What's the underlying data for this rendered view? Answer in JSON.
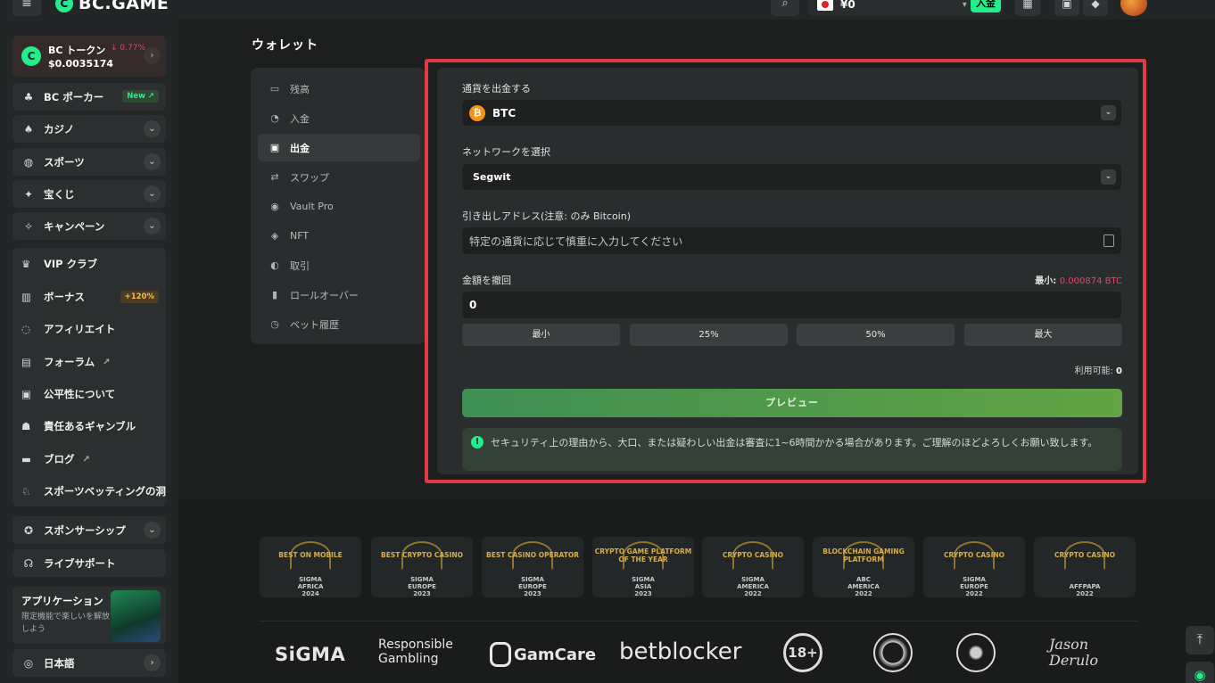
{
  "topbar": {
    "menu_icon": "menu-icon",
    "brand": "BC.GAME",
    "balance": "¥0",
    "deposit": "入金"
  },
  "sidebar": {
    "token": {
      "name": "BC トークン",
      "change": "↓ 0.77%",
      "price": "$0.0035174"
    },
    "items": [
      {
        "label": "BC ポーカー",
        "icon": "poker-icon",
        "tag": "New ↗"
      },
      {
        "label": "カジノ",
        "icon": "casino-icon"
      },
      {
        "label": "スポーツ",
        "icon": "sports-icon"
      },
      {
        "label": "宝くじ",
        "icon": "lottery-icon"
      },
      {
        "label": "キャンペーン",
        "icon": "campaign-icon"
      }
    ],
    "group": [
      {
        "label": "VIP クラブ",
        "icon": "crown-icon"
      },
      {
        "label": "ボーナス",
        "icon": "gift-icon",
        "tag": "+120%"
      },
      {
        "label": "アフィリエイト",
        "icon": "affiliate-icon"
      },
      {
        "label": "フォーラム",
        "icon": "forum-icon"
      },
      {
        "label": "公平性について",
        "icon": "fairness-icon"
      },
      {
        "label": "責任あるギャンブル",
        "icon": "responsible-icon"
      },
      {
        "label": "ブログ",
        "icon": "blog-icon"
      },
      {
        "label": "スポーツベッティングの洞",
        "icon": "sports-betting-icon"
      }
    ],
    "sponsorship": "スポンサーシップ",
    "live_support": "ライブサポート",
    "app": {
      "title": "アプリケーション",
      "desc": "限定機能で楽しいを解放しよう"
    },
    "language": "日本語"
  },
  "main": {
    "title": "ウォレット",
    "nav": [
      {
        "label": "残高",
        "icon": "wallet-icon"
      },
      {
        "label": "入金",
        "icon": "deposit-icon"
      },
      {
        "label": "出金",
        "icon": "withdraw-icon",
        "active": true
      },
      {
        "label": "スワップ",
        "icon": "swap-icon"
      },
      {
        "label": "Vault Pro",
        "icon": "vault-icon"
      },
      {
        "label": "NFT",
        "icon": "nft-icon"
      },
      {
        "label": "取引",
        "icon": "transaction-icon"
      },
      {
        "label": "ロールオーバー",
        "icon": "rollover-icon"
      },
      {
        "label": "ベット履歴",
        "icon": "history-icon"
      }
    ]
  },
  "withdraw": {
    "currency_label": "通貨を出金する",
    "currency": "BTC",
    "network_label": "ネットワークを選択",
    "network": "Segwit",
    "address_label": "引き出しアドレス(注意: のみ Bitcoin)",
    "address_placeholder": "特定の通貨に応じて慎重に入力してください",
    "amount_label": "金額を撤回",
    "min_label": "最小:",
    "min_value": "0.000874 BTC",
    "amount_value": "0",
    "quick": [
      "最小",
      "25%",
      "50%",
      "最大"
    ],
    "available_label": "利用可能:",
    "available_value": "0",
    "preview": "プレビュー",
    "notice": "セキュリティ上の理由から、大口、または疑わしい出金は審査に1~6時間かかる場合があります。ご理解のほどよろしくお願い致します。"
  },
  "awards": [
    {
      "title": "BEST ON MOBILE",
      "org": "SIGMA",
      "region": "AFRICA",
      "year": "2024"
    },
    {
      "title": "BEST CRYPTO CASINO",
      "org": "SIGMA",
      "region": "EUROPE",
      "year": "2023"
    },
    {
      "title": "BEST CASINO OPERATOR",
      "org": "SIGMA",
      "region": "EUROPE",
      "year": "2023"
    },
    {
      "title": "CRYPTO GAME PLATFORM OF THE YEAR",
      "org": "SIGMA",
      "region": "ASIA",
      "year": "2023"
    },
    {
      "title": "CRYPTO CASINO",
      "org": "SIGMA",
      "region": "AMERICA",
      "year": "2022"
    },
    {
      "title": "BLOCKCHAIN GAMING PLATFORM",
      "org": "ABC",
      "region": "AMERICA",
      "year": "2022"
    },
    {
      "title": "CRYPTO CASINO",
      "org": "SIGMA",
      "region": "EUROPE",
      "year": "2022"
    },
    {
      "title": "CRYPTO CASINO",
      "org": "",
      "region": "AFFPAPA",
      "year": "2022"
    }
  ],
  "partners": {
    "sigma": "SiGMA",
    "responsible": "Responsible Gambling",
    "gamcare": "GamCare",
    "betblocker": "betblocker",
    "age": "18+",
    "signature": "Jason Derulo"
  },
  "colors": {
    "accent": "#24ee89",
    "highlight": "#e03a45",
    "danger": "#ed4163",
    "btc": "#f7931a"
  }
}
